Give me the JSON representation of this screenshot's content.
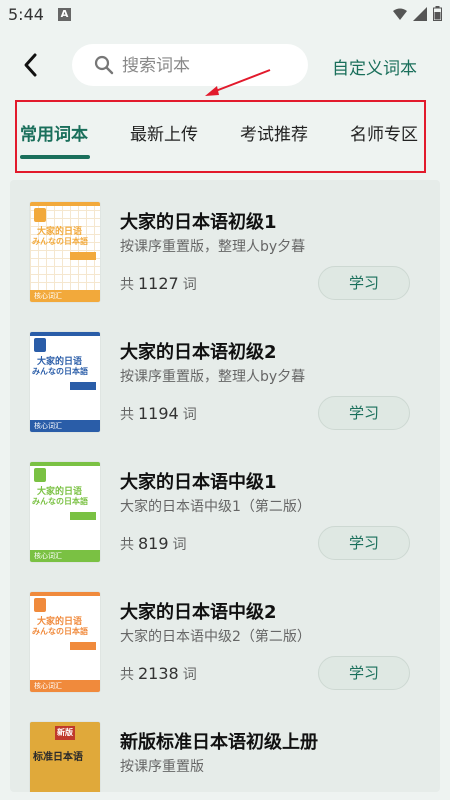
{
  "status_bar": {
    "time": "5:44",
    "a_icon": "A"
  },
  "header": {
    "back_icon": "chevron-left-icon",
    "search_placeholder": "搜索词本",
    "custom_label": "自定义词本"
  },
  "tabs": [
    {
      "label": "常用词本",
      "active": true
    },
    {
      "label": "最新上传",
      "active": false
    },
    {
      "label": "考试推荐",
      "active": false
    },
    {
      "label": "名师专区",
      "active": false
    }
  ],
  "colors": {
    "accent": "#1a6f5b",
    "highlight": "#e21a2c"
  },
  "books": [
    {
      "title": "大家的日本语初级1",
      "subtitle": "按课序重置版，整理人by夕暮",
      "count_prefix": "共",
      "count": "1127",
      "count_suffix": "词",
      "button": "学习",
      "cover_theme": "#f2a93b",
      "cover_line1": "大家的日语",
      "cover_line2": "みんなの日本語",
      "cover_bottom": "核心词汇"
    },
    {
      "title": "大家的日本语初级2",
      "subtitle": "按课序重置版，整理人by夕暮",
      "count_prefix": "共",
      "count": "1194",
      "count_suffix": "词",
      "button": "学习",
      "cover_theme": "#2a5da8",
      "cover_line1": "大家的日语",
      "cover_line2": "みんなの日本語",
      "cover_bottom": "核心词汇"
    },
    {
      "title": "大家的日本语中级1",
      "subtitle": "大家的日本语中级1（第二版）",
      "count_prefix": "共",
      "count": "819",
      "count_suffix": "词",
      "button": "学习",
      "cover_theme": "#7ac143",
      "cover_line1": "大家的日语",
      "cover_line2": "みんなの日本語",
      "cover_bottom": "核心词汇"
    },
    {
      "title": "大家的日本语中级2",
      "subtitle": "大家的日本语中级2（第二版）",
      "count_prefix": "共",
      "count": "2138",
      "count_suffix": "词",
      "button": "学习",
      "cover_theme": "#f08a3c",
      "cover_line1": "大家的日语",
      "cover_line2": "みんなの日本語",
      "cover_bottom": "核心词汇"
    },
    {
      "title": "新版标准日本语初级上册",
      "subtitle": "按课序重置版",
      "count_prefix": "",
      "count": "",
      "count_suffix": "",
      "button": "",
      "cover_theme": "#e0a93a",
      "cover_line1": "新版",
      "cover_line2": "标准日本语",
      "cover_bottom": ""
    }
  ]
}
